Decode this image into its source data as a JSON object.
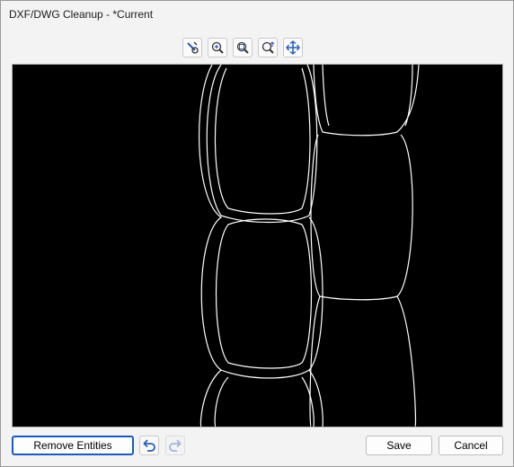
{
  "window": {
    "title": "DXF/DWG Cleanup - *Current"
  },
  "toolbar": {
    "icons": [
      "select-pick-icon",
      "zoom-in-icon",
      "zoom-window-icon",
      "zoom-extents-icon",
      "pan-icon"
    ]
  },
  "footer": {
    "remove_entities_label": "Remove Entities",
    "save_label": "Save",
    "cancel_label": "Cancel"
  },
  "colors": {
    "viewport_bg": "#000000",
    "geometry": "#ffffff",
    "icon_blue": "#2a5fb5",
    "focus_border": "#1b5bbd"
  }
}
